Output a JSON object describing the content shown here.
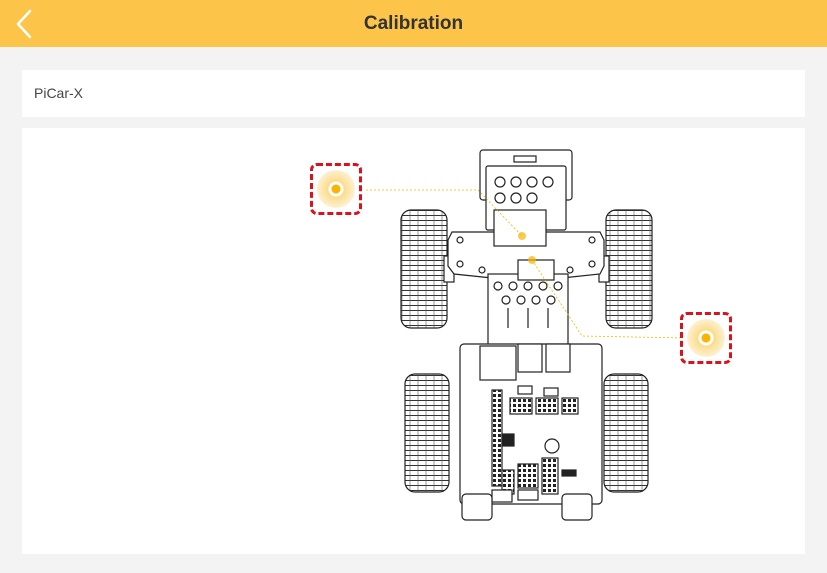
{
  "header": {
    "title": "Calibration",
    "back_icon": "chevron-left-icon",
    "background": "#fcc54a"
  },
  "device": {
    "model": "PiCar-X"
  },
  "calibration": {
    "points": [
      {
        "name": "steering-servo-calibration-point",
        "icon": "target-icon"
      },
      {
        "name": "camera-servo-calibration-point",
        "icon": "target-icon"
      }
    ],
    "highlight_color": "#d9131c",
    "accent_color": "#f7b500"
  }
}
